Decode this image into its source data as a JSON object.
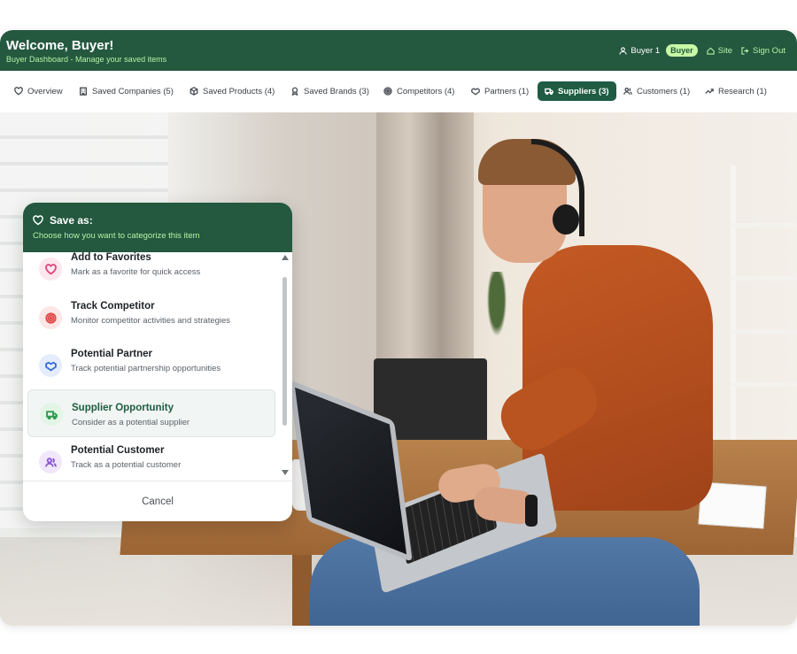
{
  "header": {
    "title": "Welcome, Buyer!",
    "subtitle": "Buyer Dashboard - Manage your saved items",
    "user_label": "Buyer 1",
    "role_badge": "Buyer",
    "site_label": "Site",
    "signout_label": "Sign Out",
    "color": "#24583f",
    "accent": "#b9f0a2"
  },
  "tabs": [
    {
      "label": "Overview",
      "icon": "heart-icon"
    },
    {
      "label": "Saved Companies (5)",
      "icon": "building-icon"
    },
    {
      "label": "Saved Products (4)",
      "icon": "box-icon"
    },
    {
      "label": "Saved Brands (3)",
      "icon": "award-icon"
    },
    {
      "label": "Competitors (4)",
      "icon": "target-icon"
    },
    {
      "label": "Partners (1)",
      "icon": "handshake-icon"
    },
    {
      "label": "Suppliers (3)",
      "icon": "truck-icon",
      "active": true
    },
    {
      "label": "Customers (1)",
      "icon": "users-icon"
    },
    {
      "label": "Research (1)",
      "icon": "trending-icon"
    }
  ],
  "dialog": {
    "title": "Save as:",
    "subtitle": "Choose how you want to categorize this item",
    "cancel_label": "Cancel",
    "options": [
      {
        "label": "Add to Favorites",
        "desc": "Mark as a favorite for quick access",
        "icon": "heart-icon",
        "color": "#e0457b"
      },
      {
        "label": "Track Competitor",
        "desc": "Monitor competitor activities and strategies",
        "icon": "target-icon",
        "color": "#e04848"
      },
      {
        "label": "Potential Partner",
        "desc": "Track potential partnership opportunities",
        "icon": "handshake-icon",
        "color": "#3b6fd8"
      },
      {
        "label": "Supplier Opportunity",
        "desc": "Consider as a potential supplier",
        "icon": "truck-icon",
        "color": "#2f9a4f",
        "selected": true
      },
      {
        "label": "Potential Customer",
        "desc": "Track as a potential customer",
        "icon": "users-icon",
        "color": "#8a55d6"
      }
    ]
  }
}
